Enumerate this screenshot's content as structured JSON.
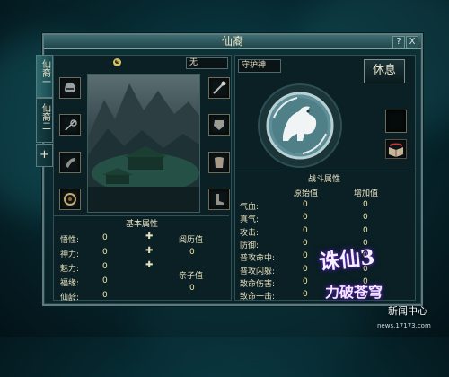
{
  "window": {
    "title": "仙裔",
    "help_label": "?",
    "close_label": "X"
  },
  "side_tabs": [
    {
      "label": "仙裔一"
    },
    {
      "label": "仙裔二"
    },
    {
      "label": "+"
    }
  ],
  "pet": {
    "name_value": "无"
  },
  "basic_attributes": {
    "header": "基本属性",
    "rows": [
      {
        "label": "悟性:",
        "value": "0"
      },
      {
        "label": "神力:",
        "value": "0"
      },
      {
        "label": "魅力:",
        "value": "0"
      },
      {
        "label": "福缘:",
        "value": "0"
      },
      {
        "label": "仙龄:",
        "value": "0"
      }
    ],
    "experience_label": "阅历值",
    "experience_value": "0",
    "affinity_label": "亲子值",
    "affinity_value": "0"
  },
  "guardian": {
    "tag": "守护神",
    "rest_button": "休息"
  },
  "combat_attributes": {
    "header": "战斗属性",
    "col_base": "原始值",
    "col_bonus": "增加值",
    "rows": [
      {
        "label": "气血:",
        "base": "0",
        "bonus": "0"
      },
      {
        "label": "真气:",
        "base": "0",
        "bonus": "0"
      },
      {
        "label": "攻击:",
        "base": "0",
        "bonus": "0"
      },
      {
        "label": "防御:",
        "base": "0",
        "bonus": "0"
      },
      {
        "label": "普攻命中:",
        "base": "0",
        "bonus": "0"
      },
      {
        "label": "普攻闪躲:",
        "base": "0",
        "bonus": "0"
      },
      {
        "label": "致命伤害:",
        "base": "0",
        "bonus": "0"
      },
      {
        "label": "致命一击:",
        "base": "0",
        "bonus": "0"
      }
    ]
  },
  "branding": {
    "logo_text": "诛仙3",
    "logo_sub": "力破苍穹",
    "site": "news.17173.com",
    "center": "新闻中心"
  },
  "colors": {
    "accent": "#5a7c7e",
    "value": "#f2e4a8",
    "logo_glow": "#6a2cc9"
  }
}
